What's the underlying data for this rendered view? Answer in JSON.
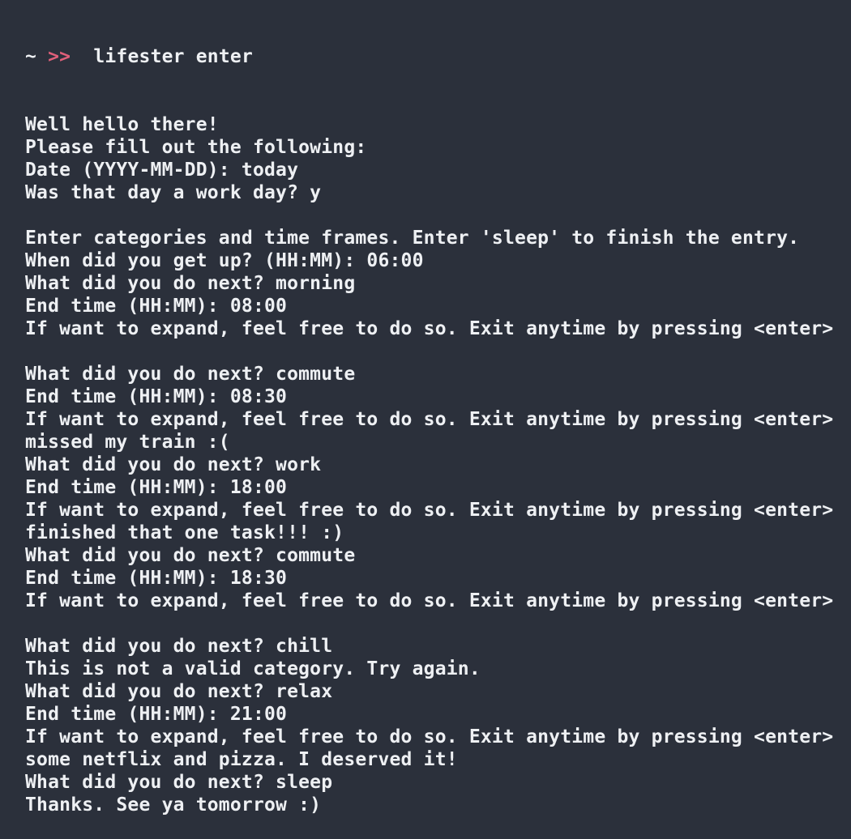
{
  "terminal": {
    "prompt": {
      "tilde": "~",
      "arrows": ">>",
      "command": "  lifester enter"
    },
    "lines": [
      "Well hello there!",
      "Please fill out the following:",
      "Date (YYYY-MM-DD): today",
      "Was that day a work day? y",
      "",
      "Enter categories and time frames. Enter 'sleep' to finish the entry.",
      "When did you get up? (HH:MM): 06:00",
      "What did you do next? morning",
      "End time (HH:MM): 08:00",
      "If want to expand, feel free to do so. Exit anytime by pressing <enter>",
      "",
      "What did you do next? commute",
      "End time (HH:MM): 08:30",
      "If want to expand, feel free to do so. Exit anytime by pressing <enter>",
      "missed my train :(",
      "What did you do next? work",
      "End time (HH:MM): 18:00",
      "If want to expand, feel free to do so. Exit anytime by pressing <enter>",
      "finished that one task!!! :)",
      "What did you do next? commute",
      "End time (HH:MM): 18:30",
      "If want to expand, feel free to do so. Exit anytime by pressing <enter>",
      "",
      "What did you do next? chill",
      "This is not a valid category. Try again.",
      "What did you do next? relax",
      "End time (HH:MM): 21:00",
      "If want to expand, feel free to do so. Exit anytime by pressing <enter>",
      "some netflix and pizza. I deserved it!",
      "What did you do next? sleep",
      "Thanks. See ya tomorrow :)"
    ]
  }
}
